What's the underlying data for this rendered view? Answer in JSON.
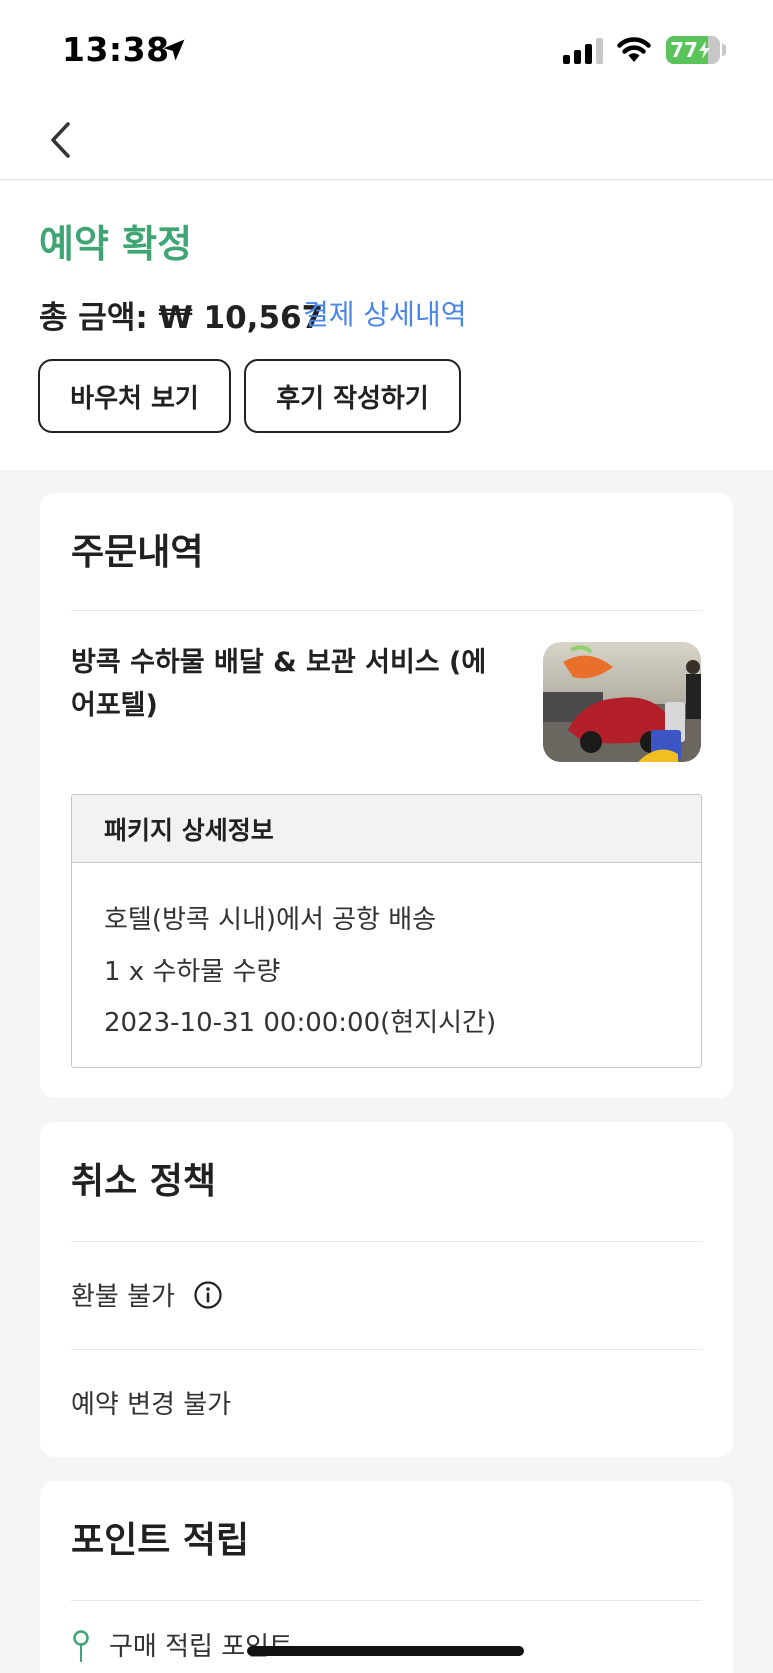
{
  "status_bar": {
    "time": "13:38",
    "battery_level": "77",
    "battery_fraction": 0.77,
    "icons": [
      "location-arrow-icon",
      "cellular-signal-icon",
      "wifi-icon",
      "battery-charging-icon"
    ]
  },
  "nav": {
    "back_icon": "chevron-left-icon"
  },
  "booking": {
    "status": "예약 확정",
    "total_label": "총 금액: ₩ 10,567",
    "payment_details_link": "결제 상세내역",
    "voucher_button": "바우처 보기",
    "review_button": "후기 작성하기"
  },
  "order": {
    "title": "주문내역",
    "product_name": "방콕 수하물 배달 & 보관 서비스 (에어포텔)",
    "package": {
      "title": "패키지 상세정보",
      "lines": [
        "호텔(방콕 시내)에서 공항 배송",
        "1 x 수하물 수량",
        "2023-10-31 00:00:00(현지시간)"
      ]
    }
  },
  "cancel_policy": {
    "title": "취소 정책",
    "items": [
      "환불 불가",
      "예약 변경 불가"
    ],
    "info_icon": "info-icon"
  },
  "points": {
    "title": "포인트 적립",
    "items": [
      "구매 적립 포인트"
    ]
  },
  "colors": {
    "accent_green": "#3fa574",
    "link_blue": "#4a86e8",
    "battery_green": "#5ac35a",
    "background": "#f5f5f5"
  }
}
